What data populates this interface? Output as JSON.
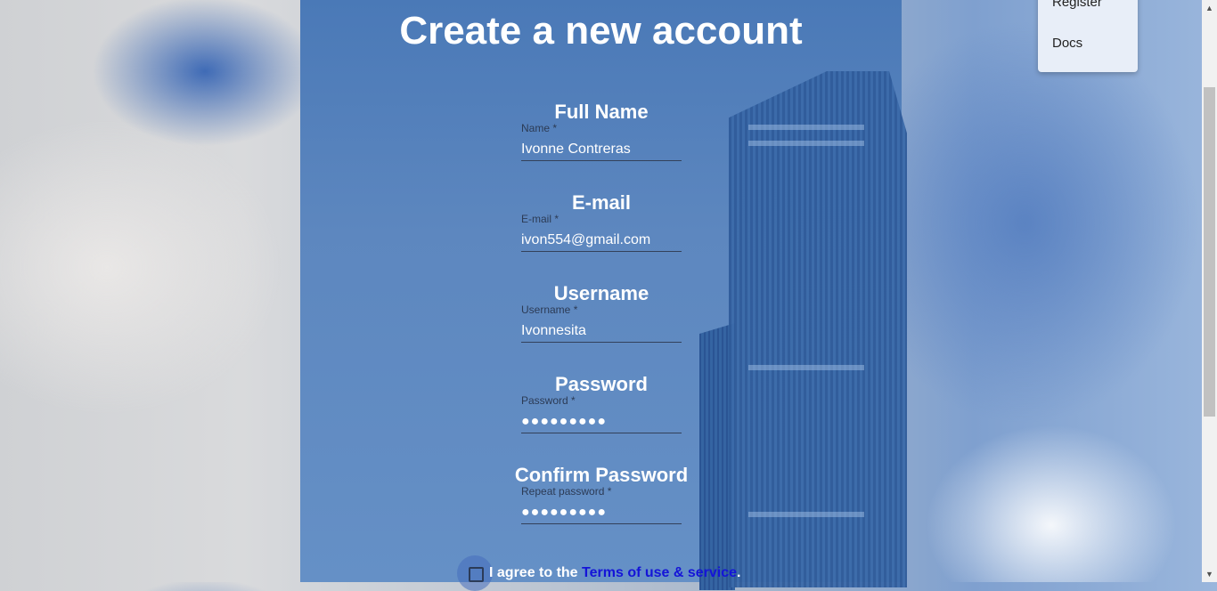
{
  "page": {
    "title": "Create a new account"
  },
  "nav_menu": {
    "items": [
      "Register",
      "Docs"
    ]
  },
  "fields": [
    {
      "heading": "Full Name",
      "label": "Name *",
      "value": "Ivonne Contreras",
      "type": "text"
    },
    {
      "heading": "E-mail",
      "label": "E-mail *",
      "value": "ivon554@gmail.com",
      "type": "text"
    },
    {
      "heading": "Username",
      "label": "Username *",
      "value": "Ivonnesita",
      "type": "text"
    },
    {
      "heading": "Password",
      "label": "Password *",
      "value": "●●●●●●●●●",
      "type": "password"
    },
    {
      "heading": "Confirm Password",
      "label": "Repeat password *",
      "value": "●●●●●●●●●",
      "type": "password"
    }
  ],
  "terms": {
    "prefix": "I agree to the ",
    "link": "Terms of use & service",
    "suffix": "."
  },
  "colors": {
    "panel": "#5a86c0",
    "link": "#1414d8",
    "text": "#ffffff"
  }
}
